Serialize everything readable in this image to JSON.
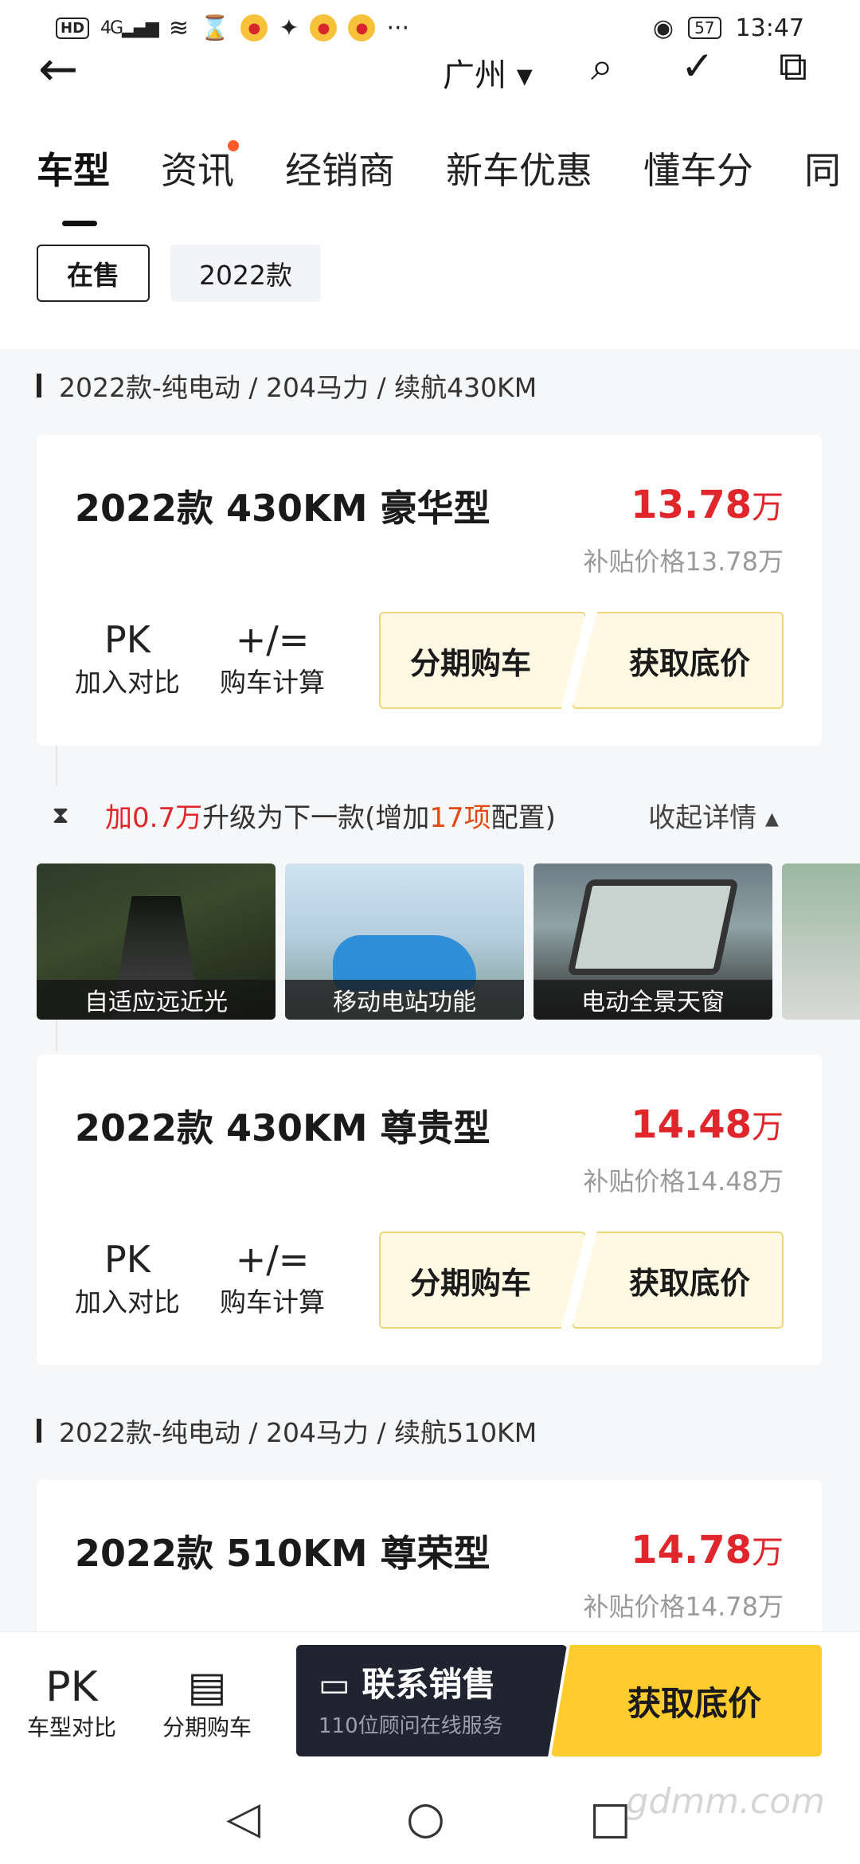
{
  "status_bar": {
    "hd": "HD",
    "network": "4G",
    "battery": "57",
    "time": "13:47",
    "more": "···"
  },
  "nav": {
    "city": "广州",
    "icons": [
      "back-arrow-icon",
      "search-icon",
      "check-icon",
      "share-icon"
    ]
  },
  "tabs": [
    "车型",
    "资讯",
    "经销商",
    "新车优惠",
    "懂车分",
    "同"
  ],
  "filters": [
    "在售",
    "2022款"
  ],
  "groups": [
    "2022款-纯电动 / 204马力 / 续航430KM",
    "2022款-纯电动 / 204马力 / 续航510KM"
  ],
  "cards": [
    {
      "title": "2022款 430KM 豪华型",
      "price": "13.78",
      "unit": "万",
      "subsidy": "补贴价格13.78万"
    },
    {
      "title": "2022款 430KM 尊贵型",
      "price": "14.48",
      "unit": "万",
      "subsidy": "补贴价格14.48万"
    },
    {
      "title": "2022款 510KM 尊荣型",
      "price": "14.78",
      "unit": "万",
      "subsidy": "补贴价格14.78万"
    }
  ],
  "actions": {
    "pk": "PK",
    "pk_label": "加入对比",
    "calc_symbol": "+/=",
    "calc_label": "购车计算",
    "installment": "分期购车",
    "get_price": "获取底价"
  },
  "upgrade": {
    "prefix": "加",
    "amount": "0.7万",
    "middle": "升级为下一款(增加",
    "count": "17项",
    "suffix": "配置)",
    "collapse": "收起详情 ▴"
  },
  "features": [
    "自适应远近光",
    "移动电站功能",
    "电动全景天窗"
  ],
  "bottom": {
    "compare_icon": "PK",
    "compare_label": "车型对比",
    "installment_label": "分期购车",
    "contact_title": "联系销售",
    "contact_sub": "110位顾问在线服务",
    "get_price": "获取底价"
  },
  "watermark": "gdmm.com"
}
